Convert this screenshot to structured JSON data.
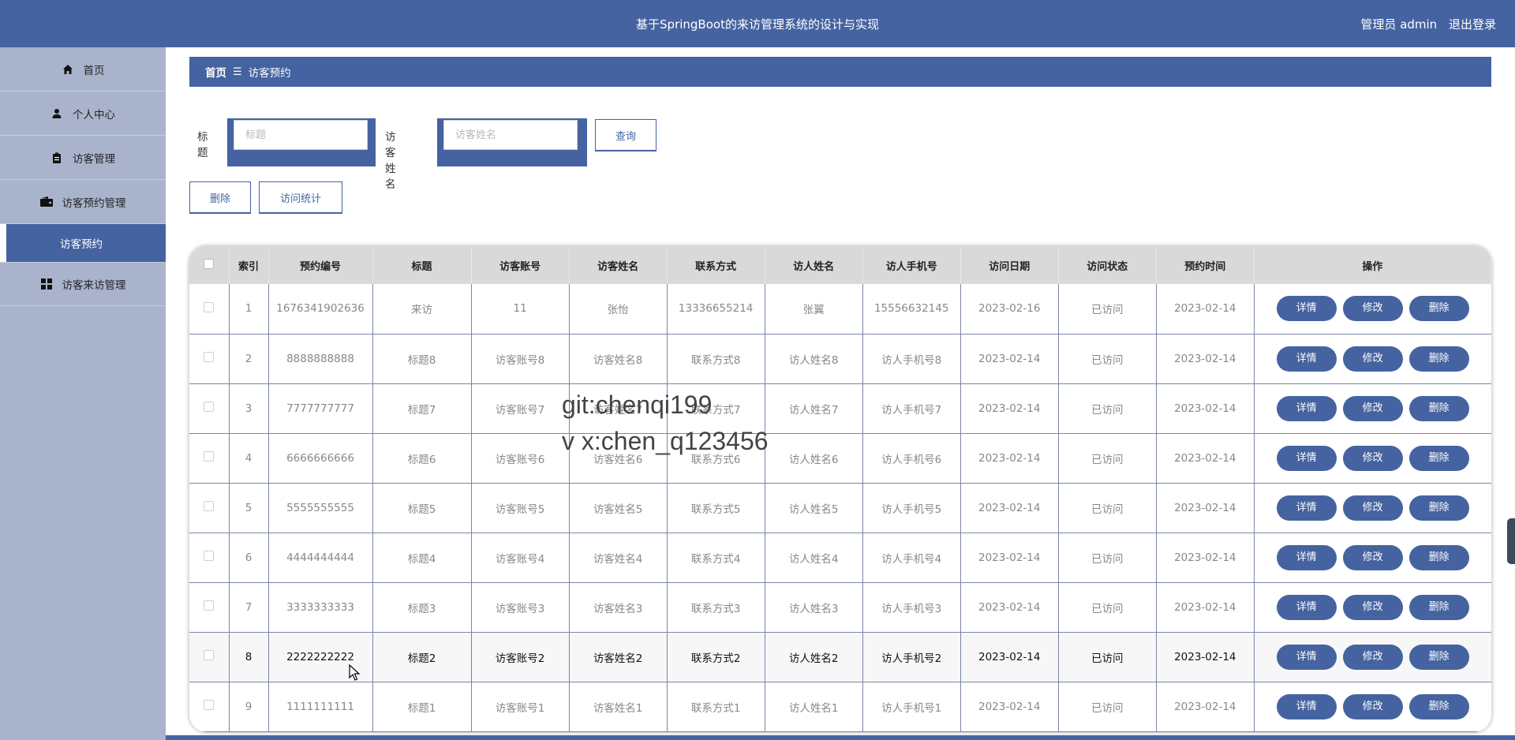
{
  "header": {
    "title": "基于SpringBoot的来访管理系统的设计与实现",
    "user_label": "管理员 admin",
    "logout_label": "退出登录"
  },
  "sidebar": {
    "items": [
      {
        "label": "首页",
        "icon": "home-icon"
      },
      {
        "label": "个人中心",
        "icon": "user-icon"
      },
      {
        "label": "访客管理",
        "icon": "clipboard-icon"
      },
      {
        "label": "访客预约管理",
        "icon": "wallet-icon"
      },
      {
        "label": "访客预约",
        "icon": "",
        "active": true
      },
      {
        "label": "访客来访管理",
        "icon": "grid-icon"
      }
    ]
  },
  "breadcrumb": {
    "home": "首页",
    "separator": "☰",
    "current": "访客预约"
  },
  "search": {
    "title_label": "标题",
    "title_placeholder": "标题",
    "name_label": "访客姓名",
    "name_placeholder": "访客姓名",
    "query_button": "查询"
  },
  "actions": {
    "delete_button": "删除",
    "stats_button": "访问统计"
  },
  "table": {
    "headers": [
      "索引",
      "预约编号",
      "标题",
      "访客账号",
      "访客姓名",
      "联系方式",
      "访人姓名",
      "访人手机号",
      "访问日期",
      "访问状态",
      "预约时间",
      "操作"
    ],
    "op_labels": [
      "详情",
      "修改",
      "删除"
    ],
    "rows": [
      {
        "index": "1",
        "code": "1676341902636",
        "title": "来访",
        "account": "11",
        "name": "张怡",
        "contact": "13336655214",
        "host": "张翼",
        "host_phone": "15556632145",
        "date": "2023-02-16",
        "status": "已访问",
        "time": "2023-02-14"
      },
      {
        "index": "2",
        "code": "8888888888",
        "title": "标题8",
        "account": "访客账号8",
        "name": "访客姓名8",
        "contact": "联系方式8",
        "host": "访人姓名8",
        "host_phone": "访人手机号8",
        "date": "2023-02-14",
        "status": "已访问",
        "time": "2023-02-14"
      },
      {
        "index": "3",
        "code": "7777777777",
        "title": "标题7",
        "account": "访客账号7",
        "name": "访客姓名7",
        "contact": "联系方式7",
        "host": "访人姓名7",
        "host_phone": "访人手机号7",
        "date": "2023-02-14",
        "status": "已访问",
        "time": "2023-02-14"
      },
      {
        "index": "4",
        "code": "6666666666",
        "title": "标题6",
        "account": "访客账号6",
        "name": "访客姓名6",
        "contact": "联系方式6",
        "host": "访人姓名6",
        "host_phone": "访人手机号6",
        "date": "2023-02-14",
        "status": "已访问",
        "time": "2023-02-14"
      },
      {
        "index": "5",
        "code": "5555555555",
        "title": "标题5",
        "account": "访客账号5",
        "name": "访客姓名5",
        "contact": "联系方式5",
        "host": "访人姓名5",
        "host_phone": "访人手机号5",
        "date": "2023-02-14",
        "status": "已访问",
        "time": "2023-02-14"
      },
      {
        "index": "6",
        "code": "4444444444",
        "title": "标题4",
        "account": "访客账号4",
        "name": "访客姓名4",
        "contact": "联系方式4",
        "host": "访人姓名4",
        "host_phone": "访人手机号4",
        "date": "2023-02-14",
        "status": "已访问",
        "time": "2023-02-14"
      },
      {
        "index": "7",
        "code": "3333333333",
        "title": "标题3",
        "account": "访客账号3",
        "name": "访客姓名3",
        "contact": "联系方式3",
        "host": "访人姓名3",
        "host_phone": "访人手机号3",
        "date": "2023-02-14",
        "status": "已访问",
        "time": "2023-02-14"
      },
      {
        "index": "8",
        "code": "2222222222",
        "title": "标题2",
        "account": "访客账号2",
        "name": "访客姓名2",
        "contact": "联系方式2",
        "host": "访人姓名2",
        "host_phone": "访人手机号2",
        "date": "2023-02-14",
        "status": "已访问",
        "time": "2023-02-14"
      },
      {
        "index": "9",
        "code": "1111111111",
        "title": "标题1",
        "account": "访客账号1",
        "name": "访客姓名1",
        "contact": "联系方式1",
        "host": "访人姓名1",
        "host_phone": "访人手机号1",
        "date": "2023-02-14",
        "status": "已访问",
        "time": "2023-02-14"
      }
    ]
  },
  "watermark": {
    "line1": "git:chenqi199",
    "line2": "v x:chen_q123456"
  },
  "colors": {
    "primary": "#4563a0",
    "sidebar_bg": "#a9b4cc",
    "header_row_bg": "#d9d9d9"
  }
}
